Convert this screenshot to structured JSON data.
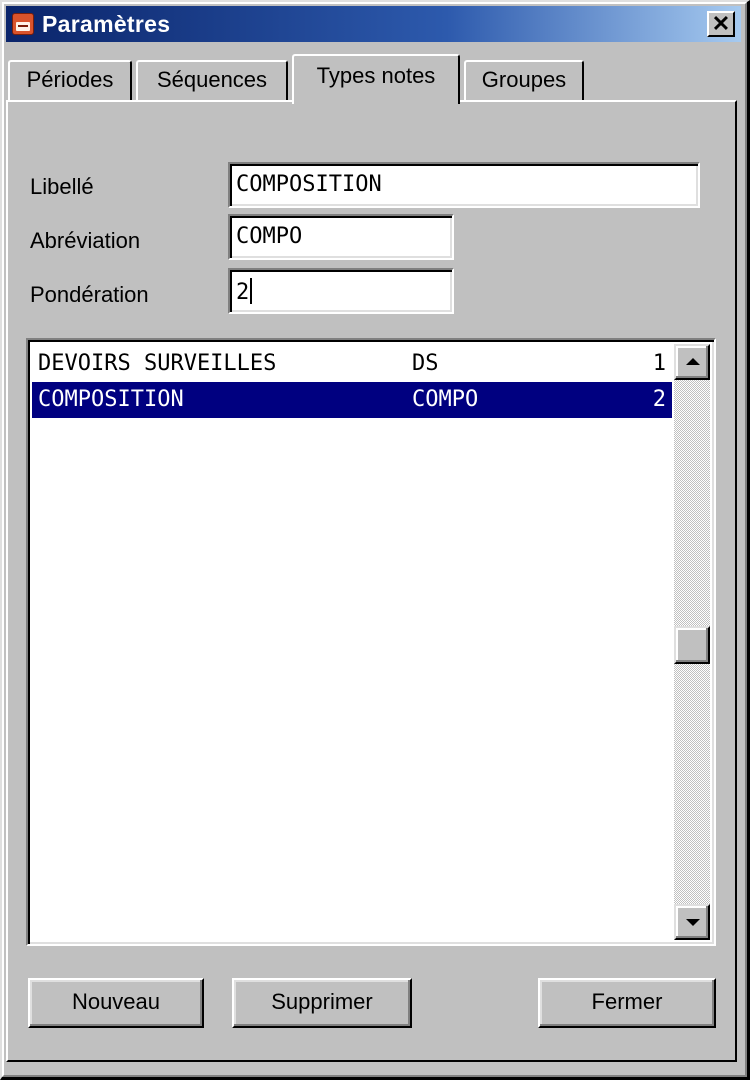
{
  "window": {
    "title": "Paramètres",
    "close_label": "✕"
  },
  "tabs": [
    {
      "label": "Périodes",
      "active": false
    },
    {
      "label": "Séquences",
      "active": false
    },
    {
      "label": "Types notes",
      "active": true
    },
    {
      "label": "Groupes",
      "active": false
    }
  ],
  "form": {
    "libelle_label": "Libellé",
    "libelle_value": "COMPOSITION",
    "abreviation_label": "Abréviation",
    "abreviation_value": "COMPO",
    "ponderation_label": "Pondération",
    "ponderation_value": "2"
  },
  "list": {
    "rows": [
      {
        "libelle": "DEVOIRS SURVEILLES",
        "abreviation": "DS",
        "ponderation": "1",
        "selected": false
      },
      {
        "libelle": "COMPOSITION",
        "abreviation": "COMPO",
        "ponderation": "2",
        "selected": true
      }
    ]
  },
  "buttons": {
    "nouveau": "Nouveau",
    "supprimer": "Supprimer",
    "fermer": "Fermer"
  },
  "colors": {
    "selection": "#000080",
    "titlebar": "#0a246a",
    "face": "#c0c0c0"
  }
}
